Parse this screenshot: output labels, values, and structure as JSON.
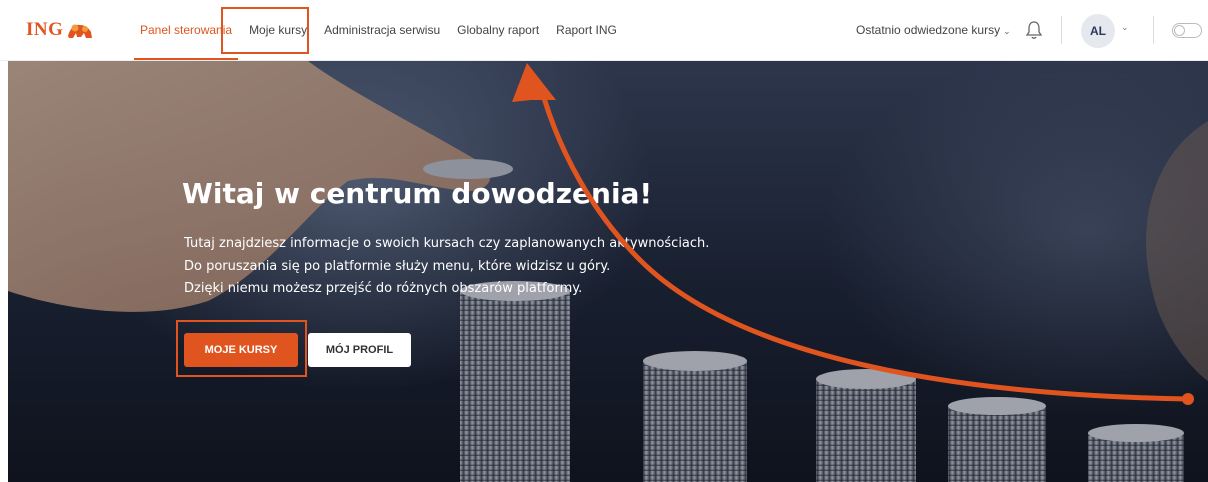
{
  "brand": {
    "name": "ING",
    "accent": "#e0551f"
  },
  "nav": {
    "items": [
      {
        "label": "Panel sterowania",
        "active": true
      },
      {
        "label": "Moje kursy",
        "active": false
      },
      {
        "label": "Administracja serwisu",
        "active": false
      },
      {
        "label": "Globalny raport",
        "active": false
      },
      {
        "label": "Raport ING",
        "active": false
      }
    ],
    "recent_courses_label": "Ostatnio odwiedzone kursy",
    "user_initials": "AL"
  },
  "hero": {
    "title": "Witaj w centrum dowodzenia!",
    "lines": [
      "Tutaj znajdziesz informacje o swoich kursach czy zaplanowanych aktywnościach.",
      "Do poruszania się po platformie służy menu, które widzisz u góry.",
      "Dzięki niemu możesz przejść do różnych obszarów platformy."
    ],
    "primary_button": "MOJE KURSY",
    "secondary_button": "MÓJ PROFIL"
  },
  "icons": {
    "logo": "ing-lion-icon",
    "recent_chevron": "chevron-down-icon",
    "notifications": "bell-icon",
    "user_chevron": "chevron-down-icon",
    "theme_toggle": "toggle-switch"
  }
}
